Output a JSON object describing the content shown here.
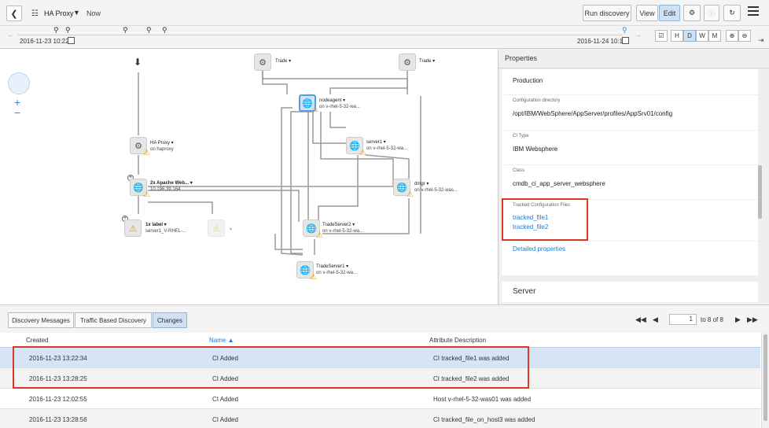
{
  "header": {
    "back_icon": "chevron-left-icon",
    "topology_icon": "topology-icon",
    "title": "HA Proxy",
    "time_mode": "Now",
    "run_discovery": "Run discovery",
    "view": "View",
    "edit": "Edit",
    "settings_icon": "gear-icon",
    "info_icon": "info-icon",
    "refresh_icon": "refresh-icon",
    "menu_icon": "hamburger-icon"
  },
  "timeline": {
    "start_date": "2016-11-23 10:22",
    "end_date": "2016-11-24 10:15",
    "scale_buttons": [
      "H",
      "D",
      "W",
      "M"
    ],
    "active_scale": "D",
    "zoom_in_icon": "zoom-in-icon",
    "zoom_out_icon": "zoom-out-icon"
  },
  "map": {
    "nodes": [
      {
        "id": "trade1",
        "label": "Trade",
        "sub": ""
      },
      {
        "id": "trade2",
        "label": "Trade",
        "sub": ""
      },
      {
        "id": "nodeagent",
        "label": "nodeagent",
        "sub": "on v-rhel-5-32-wa..."
      },
      {
        "id": "server1",
        "label": "server1",
        "sub": "on v-rhel-5-32-wa..."
      },
      {
        "id": "haproxy",
        "label": "HA Proxy",
        "sub": "on haproxy"
      },
      {
        "id": "apache",
        "label": "2x Apache Web...",
        "sub": "10.196.39.164"
      },
      {
        "id": "dmgr",
        "label": "dmgr",
        "sub": "on v-rhel-5-32-was..."
      },
      {
        "id": "label",
        "label": "1x label",
        "sub": "server1_V-RHEL-..."
      },
      {
        "id": "tradeserver2",
        "label": "TradeServer2",
        "sub": "on v-rhel-5-32-wa..."
      },
      {
        "id": "tradeserver1",
        "label": "TradeServer1",
        "sub": "on v-rhel-5-32-wa..."
      }
    ]
  },
  "properties": {
    "title": "Properties",
    "environment": "Production",
    "config_dir_label": "Configuration directory",
    "config_dir_value": "/opt/IBM/WebSphere/AppServer/profiles/AppSrv01/config",
    "ci_type_label": "CI Type",
    "ci_type_value": "IBM Websphere",
    "class_label": "Class",
    "class_value": "cmdb_ci_app_server_websphere",
    "tracked_label": "Tracked Configuration Files",
    "tracked_files": [
      "tracked_file1",
      "tracked_file2"
    ],
    "detailed_link": "Detailed properties",
    "server_section": "Server"
  },
  "bottom": {
    "tabs": [
      "Discovery Messages",
      "Traffic Based Discovery",
      "Changes"
    ],
    "active_tab": "Changes",
    "pager": {
      "current_page": "1",
      "of_text": "to 8 of 8"
    },
    "columns": [
      "Created",
      "Name",
      "Attribute Description"
    ],
    "sort_indicator": "▲",
    "rows": [
      {
        "created": "2016-11-23 13:22:34",
        "name": "CI Added",
        "description": "CI tracked_file1 was added"
      },
      {
        "created": "2016-11-23 13:28:25",
        "name": "CI Added",
        "description": "CI tracked_file2 was added"
      },
      {
        "created": "2016-11-23 12:02:55",
        "name": "CI Added",
        "description": "Host v-rhel-5-32-was01 was added"
      },
      {
        "created": "2016-11-23 13:28:56",
        "name": "CI Added",
        "description": "CI tracked_file_on_host3 was added"
      }
    ]
  },
  "colors": {
    "accent": "#1f7ad1",
    "highlight_box": "#d63a22",
    "selected_row": "#d5e5f6",
    "warning": "#e3a300"
  }
}
